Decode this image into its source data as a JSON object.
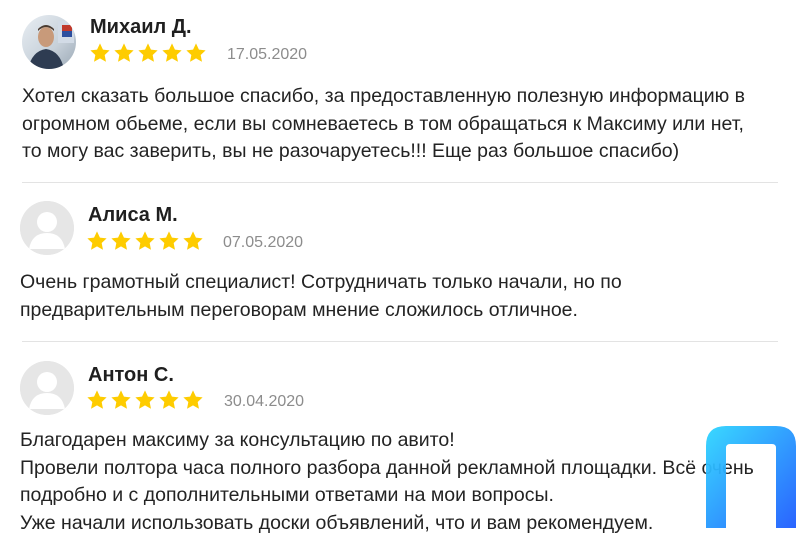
{
  "reviews": [
    {
      "name": "Михаил Д.",
      "rating": 5,
      "date": "17.05.2020",
      "avatar": "user-photo",
      "lines": [
        "Хотел сказать большое спасибо, за предоставленную полезную информацию в",
        "огромном обьеме, если вы сомневаетесь в том обращаться к Максиму или нет,",
        "то могу вас заверить, вы не разочаруетесь!!! Еще раз большое спасибо)"
      ]
    },
    {
      "name": "Алиса М.",
      "rating": 5,
      "date": "07.05.2020",
      "avatar": "default-user-icon",
      "lines": [
        "Очень грамотный специалист! Сотрудничать только начали, но по",
        "предварительным переговорам мнение сложилось отличное."
      ]
    },
    {
      "name": "Антон С.",
      "rating": 5,
      "date": "30.04.2020",
      "avatar": "default-user-icon",
      "lines": [
        "Благодарен максиму за консультацию по авито!",
        "Провели полтора часа полного разбора данной рекламной площадки. Всё очень",
        "подробно и с дополнительными ответами на мои вопросы.",
        "Уже начали использовать доски объявлений, что и вам рекомендуем."
      ]
    }
  ],
  "colors": {
    "star": "#fecc00",
    "date": "#8c8c8c",
    "divider": "#e3e3e3",
    "watermark_gradient": [
      "#2fd7ff",
      "#1f5bff"
    ]
  },
  "icons": {
    "rating": "star-icon",
    "watermark": "brand-logo-icon"
  }
}
